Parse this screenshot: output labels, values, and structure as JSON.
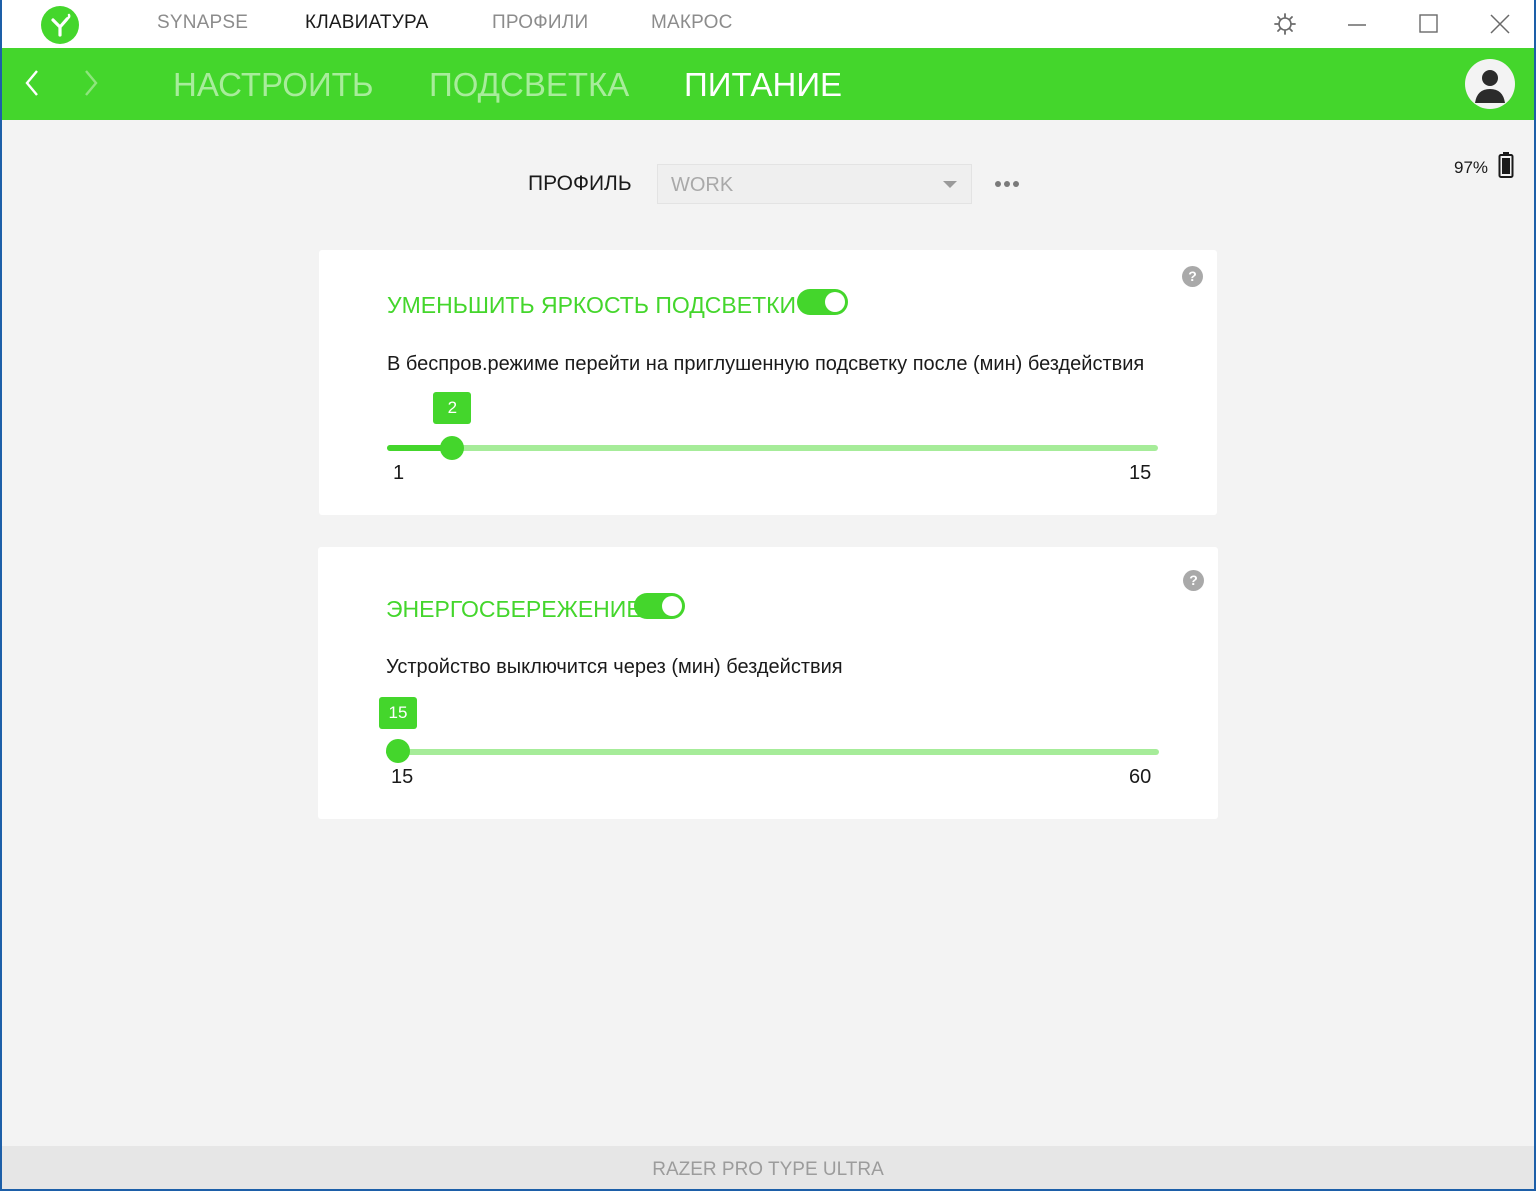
{
  "titlebar": {
    "tabs": [
      {
        "label": "SYNAPSE",
        "active": false
      },
      {
        "label": "КЛАВИАТУРА",
        "active": true
      },
      {
        "label": "ПРОФИЛИ",
        "active": false
      },
      {
        "label": "МАКРОС",
        "active": false
      }
    ]
  },
  "nav": {
    "tabs": [
      {
        "label": "НАСТРОИТЬ",
        "active": false
      },
      {
        "label": "ПОДСВЕТКА",
        "active": false
      },
      {
        "label": "ПИТАНИЕ",
        "active": true
      }
    ]
  },
  "battery": {
    "level": "97%"
  },
  "profile": {
    "label": "ПРОФИЛЬ",
    "value": "WORK"
  },
  "dim_lighting": {
    "title": "УМЕНЬШИТЬ ЯРКОСТЬ ПОДСВЕТКИ",
    "enabled": true,
    "description": "В беспров.режиме перейти на приглушенную подсветку после (мин) бездействия",
    "slider": {
      "value": 2,
      "min": 1,
      "max": 15,
      "value_label": "2",
      "min_label": "1",
      "max_label": "15"
    }
  },
  "power_saving": {
    "title": "ЭНЕРГОСБЕРЕЖЕНИЕ",
    "enabled": true,
    "description": "Устройство выключится через (мин) бездействия",
    "slider": {
      "value": 15,
      "min": 15,
      "max": 60,
      "value_label": "15",
      "min_label": "15",
      "max_label": "60"
    }
  },
  "help": {
    "symbol": "?"
  },
  "footer": {
    "device_name": "RAZER PRO TYPE ULTRA"
  },
  "colors": {
    "accent": "#44d62c",
    "track": "#a6ec99",
    "background": "#f3f3f3"
  }
}
